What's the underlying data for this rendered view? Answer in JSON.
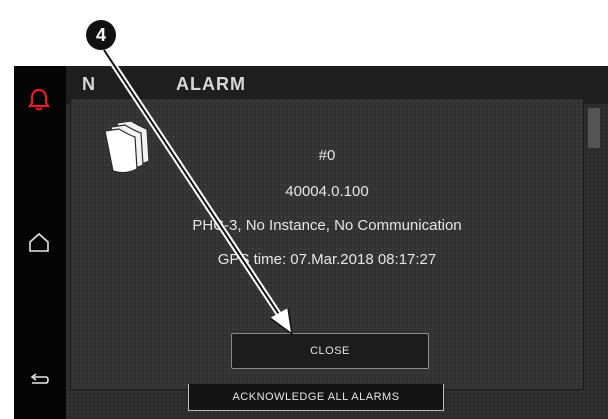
{
  "header": {
    "title": "ALARM",
    "left_glyph": "N"
  },
  "dialog": {
    "alarm_number": "#0",
    "alarm_code": "40004.0.100",
    "alarm_description": "PHC-3, No Instance, No Communication",
    "gps_time": "GPS time: 07.Mar.2018 08:17:27",
    "close_label": "CLOSE"
  },
  "footer": {
    "acknowledge_label": "ACKNOWLEDGE ALL ALARMS"
  },
  "callout": {
    "number": "4"
  },
  "icons": {
    "alarm": "bell-icon",
    "home": "home-icon",
    "back": "back-arrow-icon",
    "document": "documents-icon"
  },
  "colors": {
    "alarm_accent": "#e0202a",
    "background": "#141414",
    "text": "#e6e6e6"
  }
}
